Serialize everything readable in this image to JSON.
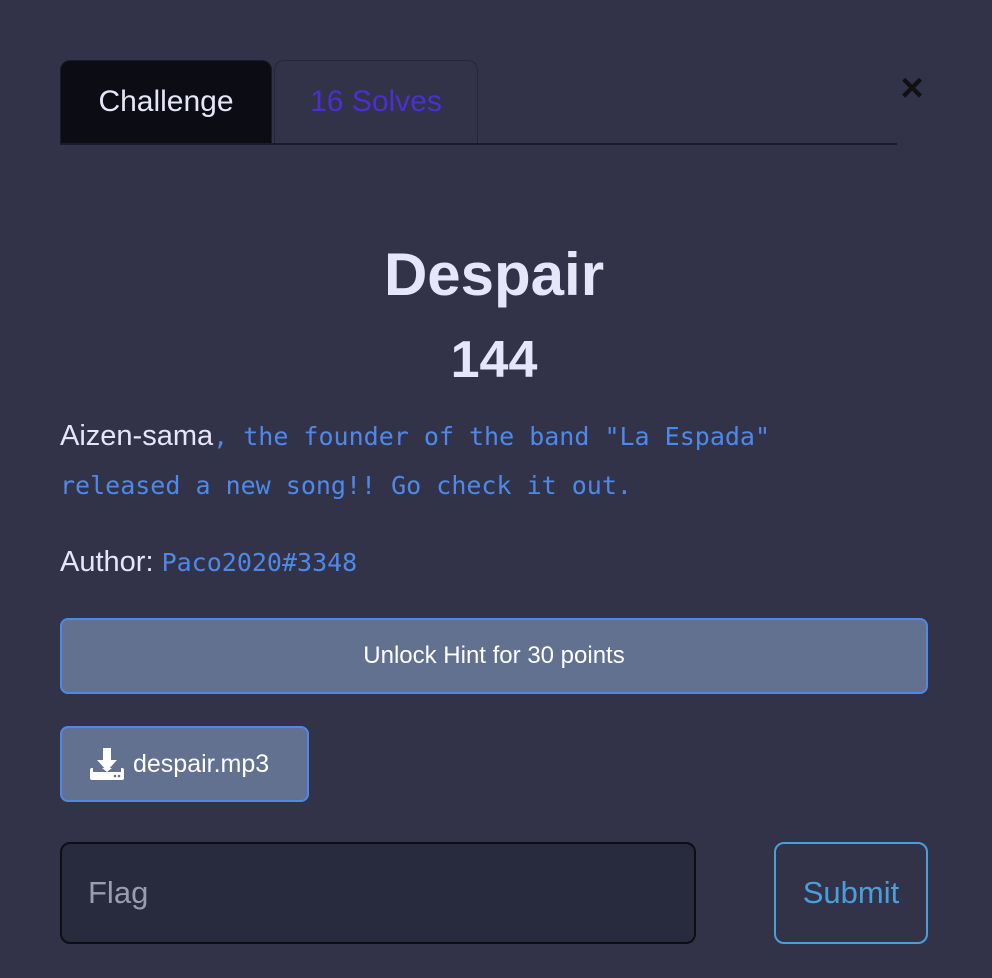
{
  "tabs": [
    {
      "label": "Challenge"
    },
    {
      "label": "16 Solves"
    }
  ],
  "close_label": "×",
  "challenge": {
    "name": "Despair",
    "value": "144",
    "description": {
      "lead": "Aizen-sama",
      "rest_line1": ", the founder of the band \"La Espada\"",
      "rest_line2": "released a new song!! Go check it out."
    },
    "author_label": "Author: ",
    "author_handle": "Paco2020#3348"
  },
  "hint_button": "Unlock Hint for 30 points",
  "file": {
    "name": "despair.mp3",
    "icon": "download-icon"
  },
  "flag_input": {
    "placeholder": "Flag",
    "value": ""
  },
  "submit_label": "Submit",
  "colors": {
    "background": "#323349",
    "active_tab": "#0c0c15",
    "link": "#4e89ea",
    "submit": "#4a9fda",
    "button_bg": "#627190",
    "solves_tab_text": "#4b2fd0"
  }
}
